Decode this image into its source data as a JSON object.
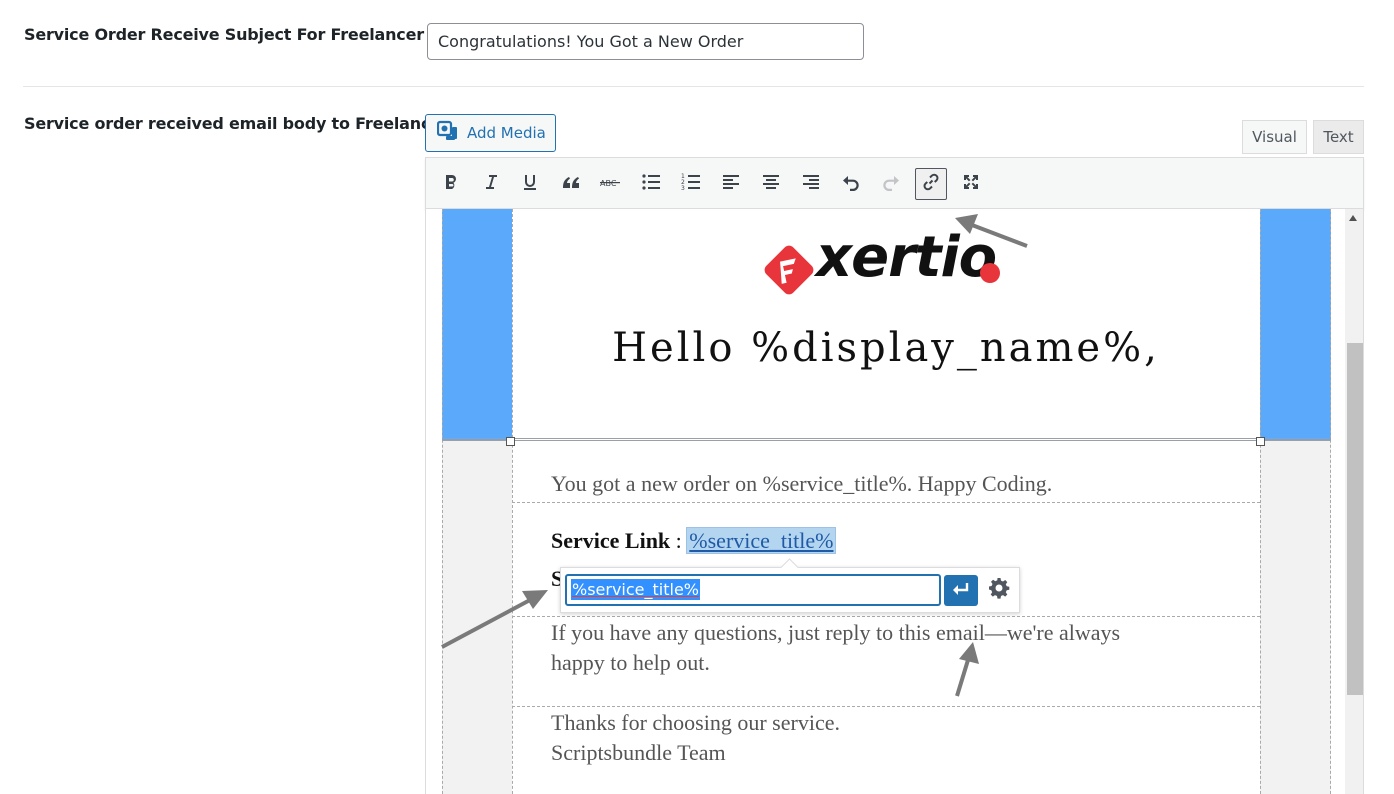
{
  "subject_row": {
    "label": "Service Order Receive Subject For Freelancer",
    "value": "Congratulations! You Got a New Order"
  },
  "body_row": {
    "label": "Service order received email body to Freelancer"
  },
  "editor": {
    "add_media_label": "Add Media",
    "tabs": {
      "visual": "Visual",
      "text": "Text"
    },
    "toolbar": [
      {
        "name": "bold",
        "icon": "bold-icon"
      },
      {
        "name": "italic",
        "icon": "italic-icon"
      },
      {
        "name": "underline",
        "icon": "underline-icon"
      },
      {
        "name": "blockquote",
        "icon": "blockquote-icon"
      },
      {
        "name": "strikethrough",
        "icon": "strikethrough-icon"
      },
      {
        "name": "bullet-list",
        "icon": "bullet-list-icon"
      },
      {
        "name": "numbered-list",
        "icon": "numbered-list-icon"
      },
      {
        "name": "align-left",
        "icon": "align-left-icon"
      },
      {
        "name": "align-center",
        "icon": "align-center-icon"
      },
      {
        "name": "align-right",
        "icon": "align-right-icon"
      },
      {
        "name": "undo",
        "icon": "undo-icon"
      },
      {
        "name": "redo",
        "icon": "redo-icon",
        "disabled": true
      },
      {
        "name": "insert-link",
        "icon": "link-icon",
        "active": true
      },
      {
        "name": "fullscreen",
        "icon": "fullscreen-icon"
      }
    ]
  },
  "email": {
    "logo_text": "xertio",
    "greeting": "Hello %display_name%,",
    "intro": "You got a new order on %service_title%. Happy Coding.",
    "service_link_label": "Service Link",
    "service_link_sep": " : ",
    "service_link_value": "%service_title%",
    "next_line_initial": "S",
    "questions_line1": "If you have any questions, just reply to this email—we're always",
    "questions_line2": "happy to help out.",
    "thanks": "Thanks for choosing our service.",
    "team": "Scriptsbundle Team"
  },
  "link_popup": {
    "url_value": "%service_title%",
    "apply_icon": "enter-icon",
    "options_icon": "gear-icon"
  },
  "colors": {
    "accent": "#2271b1",
    "email_blue": "#5aa9fb",
    "logo_red": "#e8353b"
  }
}
